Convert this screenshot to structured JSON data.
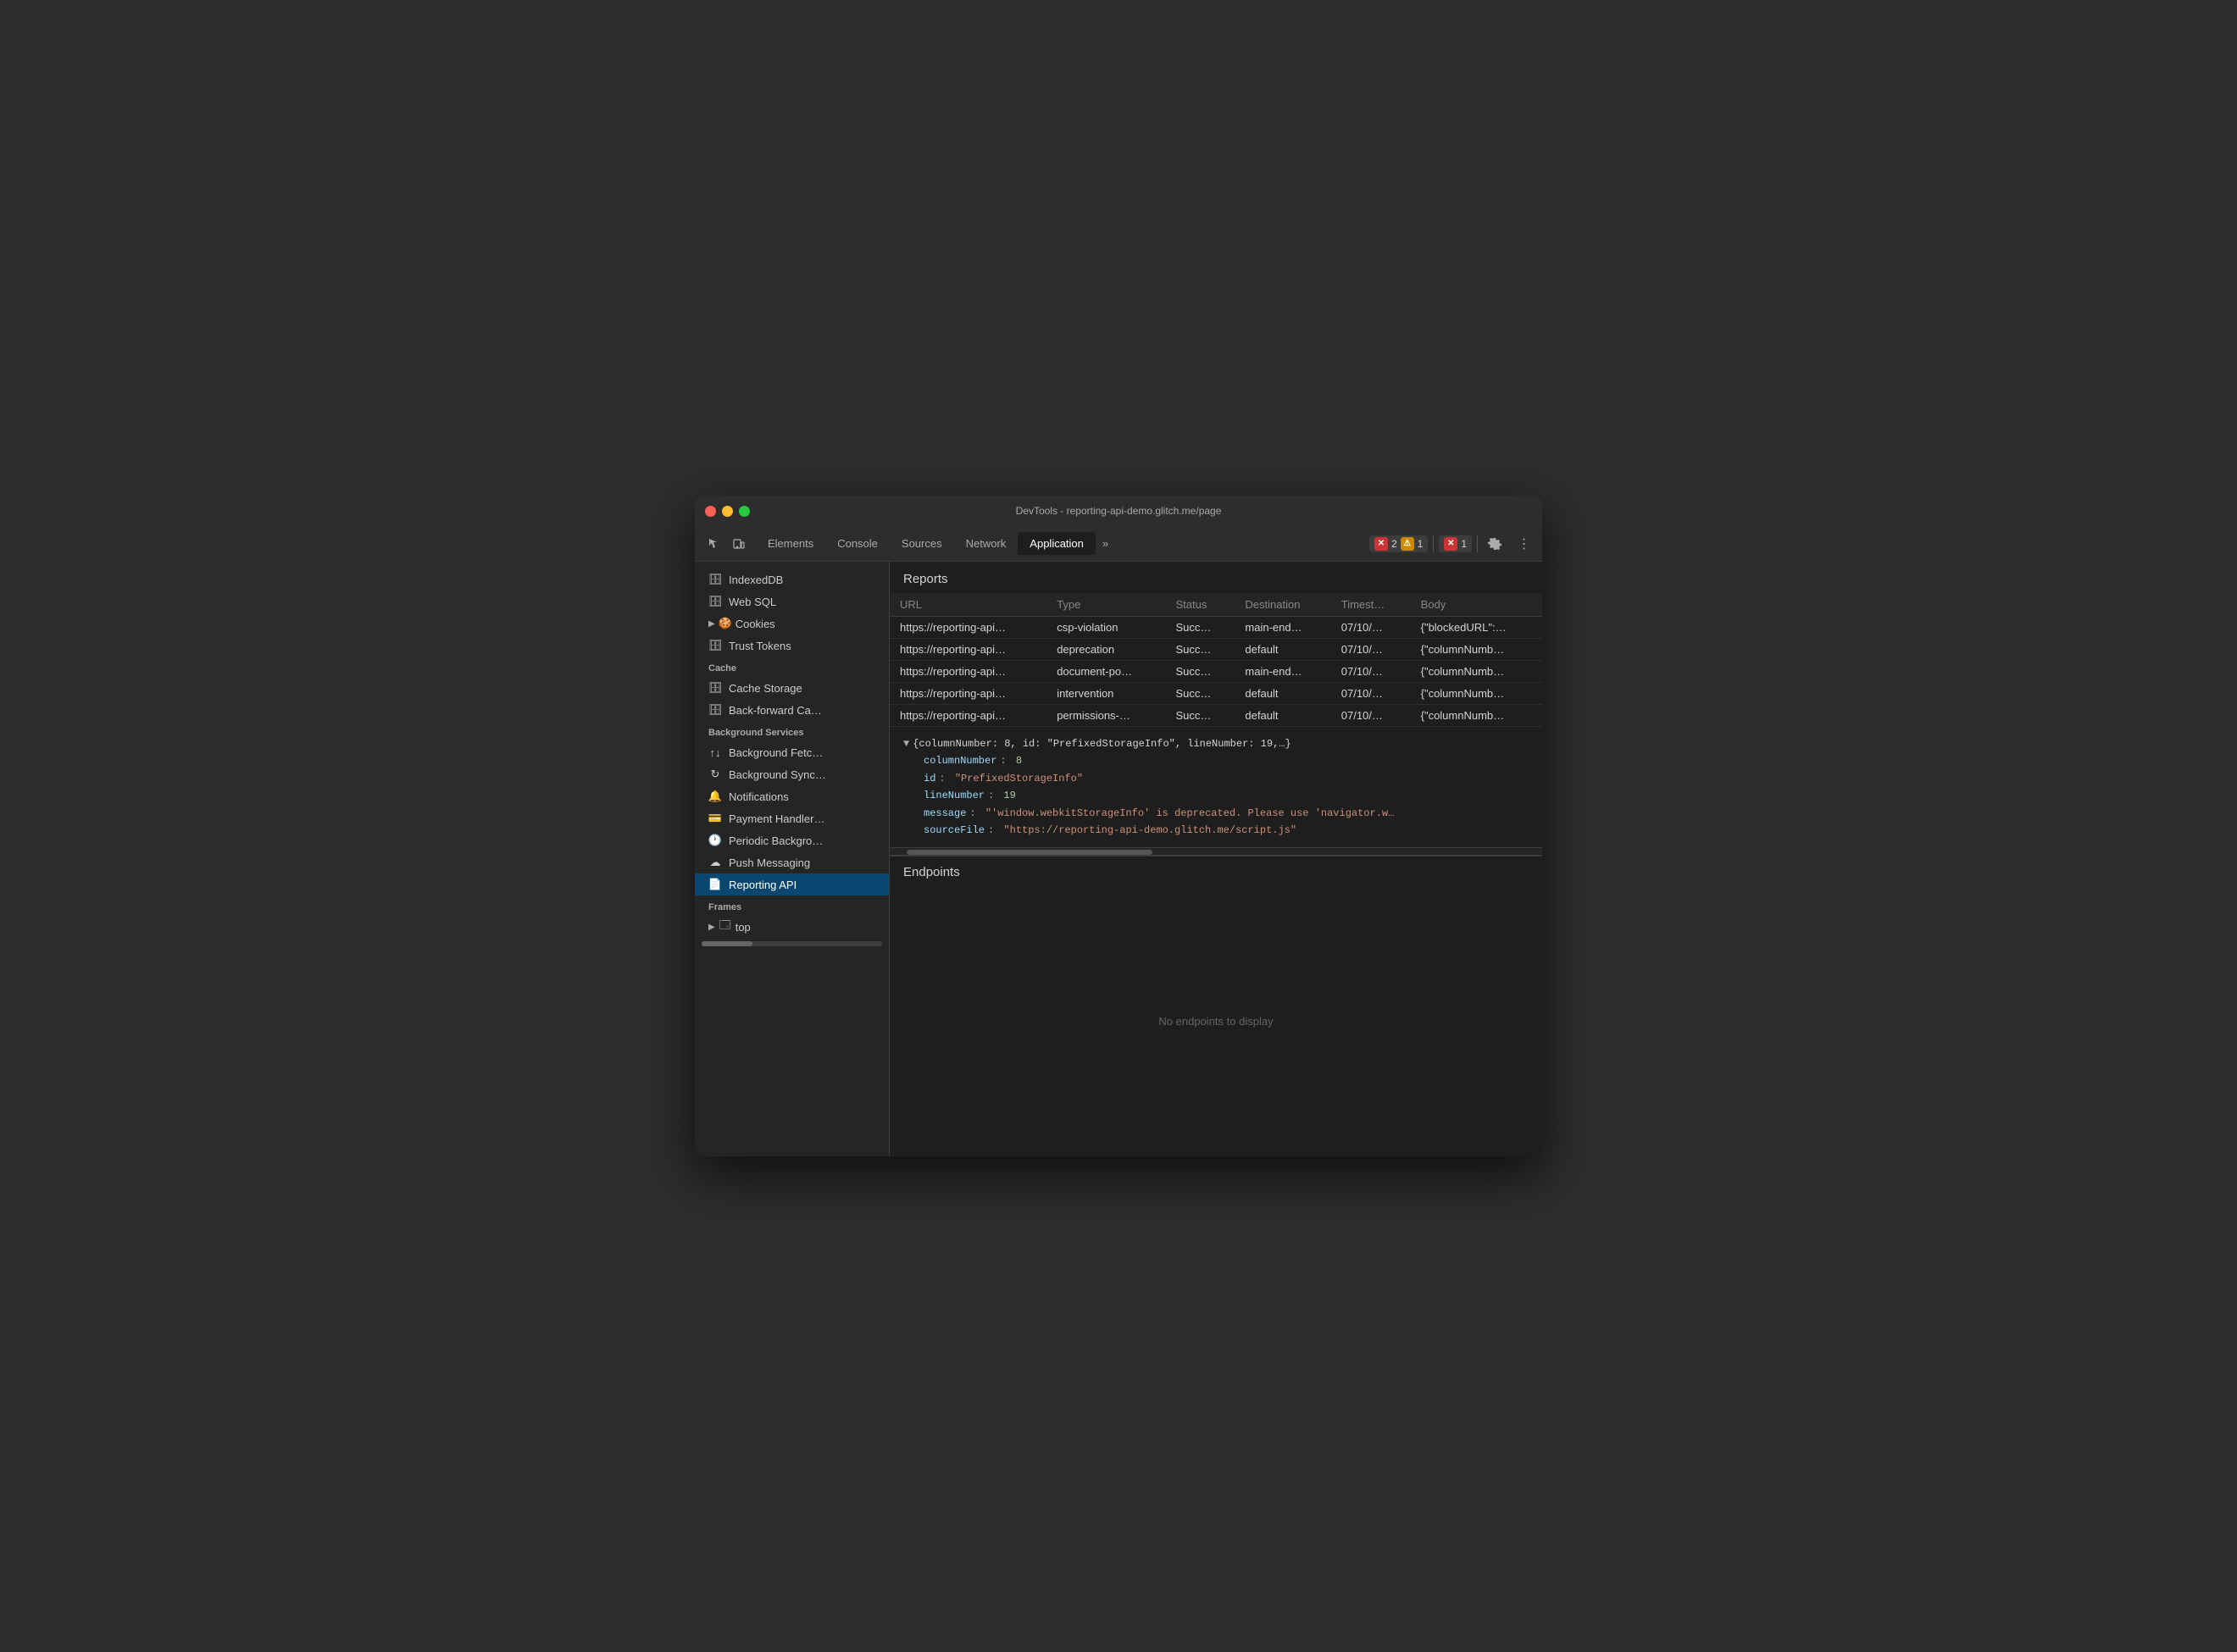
{
  "titlebar": {
    "title": "DevTools - reporting-api-demo.glitch.me/page"
  },
  "toolbar": {
    "tabs": [
      {
        "id": "elements",
        "label": "Elements",
        "active": false
      },
      {
        "id": "console",
        "label": "Console",
        "active": false
      },
      {
        "id": "sources",
        "label": "Sources",
        "active": false
      },
      {
        "id": "network",
        "label": "Network",
        "active": false
      },
      {
        "id": "application",
        "label": "Application",
        "active": true
      }
    ],
    "overflow_label": "»",
    "badge_error_count": "2",
    "badge_warning_count": "1",
    "badge_error2_count": "1"
  },
  "sidebar": {
    "indexed_db": "IndexedDB",
    "web_sql": "Web SQL",
    "cookies": "Cookies",
    "trust_tokens": "Trust Tokens",
    "cache_label": "Cache",
    "cache_storage": "Cache Storage",
    "back_forward": "Back-forward Ca…",
    "bg_services_label": "Background Services",
    "bg_fetch": "Background Fetc…",
    "bg_sync": "Background Sync…",
    "notifications": "Notifications",
    "payment_handler": "Payment Handler…",
    "periodic_bg": "Periodic Backgro…",
    "push_messaging": "Push Messaging",
    "reporting_api": "Reporting API",
    "frames_label": "Frames",
    "frames_top": "top"
  },
  "reports": {
    "section_title": "Reports",
    "columns": [
      "URL",
      "Type",
      "Status",
      "Destination",
      "Timest…",
      "Body"
    ],
    "rows": [
      {
        "url": "https://reporting-api…",
        "type": "csp-violation",
        "status": "Succ…",
        "destination": "main-end…",
        "timestamp": "07/10/…",
        "body": "{\"blockedURL\":…"
      },
      {
        "url": "https://reporting-api…",
        "type": "deprecation",
        "status": "Succ…",
        "destination": "default",
        "timestamp": "07/10/…",
        "body": "{\"columnNumb…"
      },
      {
        "url": "https://reporting-api…",
        "type": "document-po…",
        "status": "Succ…",
        "destination": "main-end…",
        "timestamp": "07/10/…",
        "body": "{\"columnNumb…"
      },
      {
        "url": "https://reporting-api…",
        "type": "intervention",
        "status": "Succ…",
        "destination": "default",
        "timestamp": "07/10/…",
        "body": "{\"columnNumb…"
      },
      {
        "url": "https://reporting-api…",
        "type": "permissions-…",
        "status": "Succ…",
        "destination": "default",
        "timestamp": "07/10/…",
        "body": "{\"columnNumb…"
      }
    ]
  },
  "json_detail": {
    "summary": "{columnNumber: 8, id: \"PrefixedStorageInfo\", lineNumber: 19,…}",
    "fields": [
      {
        "key": "columnNumber",
        "value": "8",
        "type": "number"
      },
      {
        "key": "id",
        "value": "\"PrefixedStorageInfo\"",
        "type": "string"
      },
      {
        "key": "lineNumber",
        "value": "19",
        "type": "number"
      },
      {
        "key": "message",
        "value": "\"'window.webkitStorageInfo' is deprecated. Please use 'navigator.w…",
        "type": "string"
      },
      {
        "key": "sourceFile",
        "value": "\"https://reporting-api-demo.glitch.me/script.js\"",
        "type": "string"
      }
    ]
  },
  "endpoints": {
    "title": "Endpoints",
    "empty_text": "No endpoints to display"
  }
}
